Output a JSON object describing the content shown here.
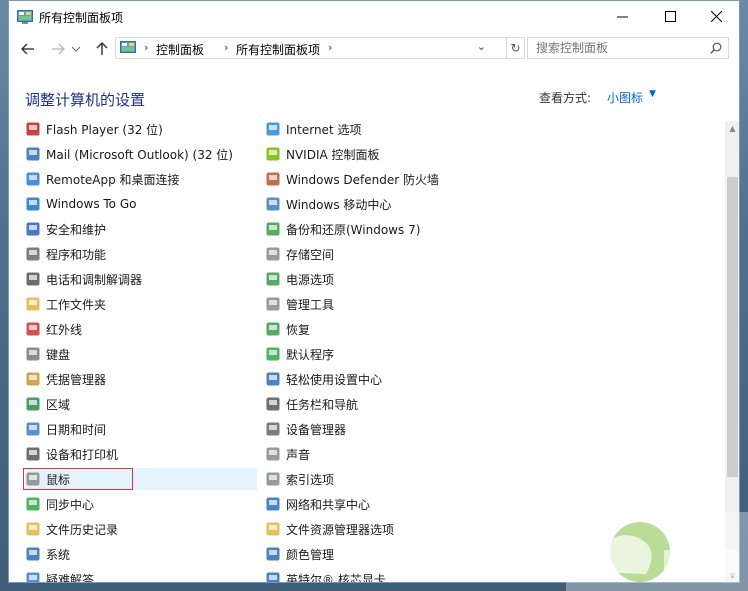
{
  "window": {
    "title": "所有控制面板项"
  },
  "nav": {
    "breadcrumb": [
      "控制面板",
      "所有控制面板项"
    ],
    "search_placeholder": "搜索控制面板"
  },
  "header": {
    "title": "调整计算机的设置",
    "view_by_label": "查看方式:",
    "view_by_value": "小图标"
  },
  "items_left": [
    {
      "label": "Flash Player (32 位)",
      "icon": "flash-icon"
    },
    {
      "label": "Mail (Microsoft Outlook) (32 位)",
      "icon": "mail-icon"
    },
    {
      "label": "RemoteApp 和桌面连接",
      "icon": "remoteapp-icon"
    },
    {
      "label": "Windows To Go",
      "icon": "windows-to-go-icon"
    },
    {
      "label": "安全和维护",
      "icon": "flag-icon"
    },
    {
      "label": "程序和功能",
      "icon": "programs-icon"
    },
    {
      "label": "电话和调制解调器",
      "icon": "phone-modem-icon"
    },
    {
      "label": "工作文件夹",
      "icon": "work-folders-icon"
    },
    {
      "label": "红外线",
      "icon": "infrared-icon"
    },
    {
      "label": "键盘",
      "icon": "keyboard-icon"
    },
    {
      "label": "凭据管理器",
      "icon": "credential-icon"
    },
    {
      "label": "区域",
      "icon": "region-icon"
    },
    {
      "label": "日期和时间",
      "icon": "calendar-icon"
    },
    {
      "label": "设备和打印机",
      "icon": "printer-icon"
    },
    {
      "label": "鼠标",
      "icon": "mouse-icon"
    },
    {
      "label": "同步中心",
      "icon": "sync-icon"
    },
    {
      "label": "文件历史记录",
      "icon": "file-history-icon"
    },
    {
      "label": "系统",
      "icon": "system-icon"
    },
    {
      "label": "疑难解答",
      "icon": "troubleshoot-icon"
    }
  ],
  "items_right": [
    {
      "label": "Internet 选项",
      "icon": "internet-options-icon"
    },
    {
      "label": "NVIDIA 控制面板",
      "icon": "nvidia-icon"
    },
    {
      "label": "Windows Defender 防火墙",
      "icon": "firewall-icon"
    },
    {
      "label": "Windows 移动中心",
      "icon": "mobility-center-icon"
    },
    {
      "label": "备份和还原(Windows 7)",
      "icon": "backup-icon"
    },
    {
      "label": "存储空间",
      "icon": "storage-icon"
    },
    {
      "label": "电源选项",
      "icon": "power-icon"
    },
    {
      "label": "管理工具",
      "icon": "admin-tools-icon"
    },
    {
      "label": "恢复",
      "icon": "recovery-icon"
    },
    {
      "label": "默认程序",
      "icon": "default-programs-icon"
    },
    {
      "label": "轻松使用设置中心",
      "icon": "ease-of-access-icon"
    },
    {
      "label": "任务栏和导航",
      "icon": "taskbar-icon"
    },
    {
      "label": "设备管理器",
      "icon": "device-manager-icon"
    },
    {
      "label": "声音",
      "icon": "sound-icon"
    },
    {
      "label": "索引选项",
      "icon": "indexing-icon"
    },
    {
      "label": "网络和共享中心",
      "icon": "network-icon"
    },
    {
      "label": "文件资源管理器选项",
      "icon": "folder-options-icon"
    },
    {
      "label": "颜色管理",
      "icon": "color-management-icon"
    },
    {
      "label": "英特尔® 核芯显卡",
      "icon": "intel-graphics-icon"
    }
  ],
  "highlighted_item": "鼠标",
  "colors": {
    "title": "#1e3287",
    "link": "#0066cc",
    "highlight": "#e5f3ff",
    "annotation": "#d63b3b"
  }
}
